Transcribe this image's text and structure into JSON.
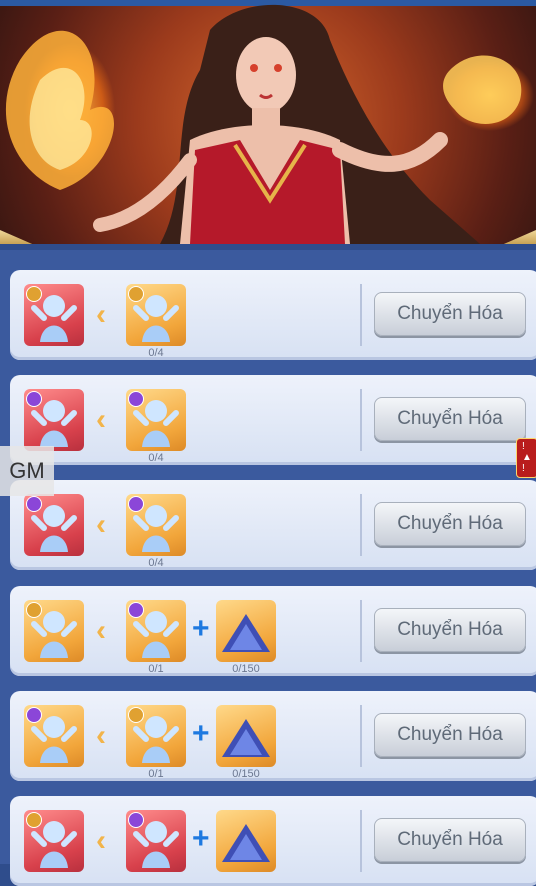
{
  "rows": [
    {
      "button_label": "Chuyển Hóa",
      "input_count": "0/4",
      "extra_count": ""
    },
    {
      "button_label": "Chuyển Hóa",
      "input_count": "0/4",
      "extra_count": ""
    },
    {
      "button_label": "Chuyển Hóa",
      "input_count": "0/4",
      "extra_count": ""
    },
    {
      "button_label": "Chuyển Hóa",
      "input_count": "0/1",
      "extra_count": "0/150"
    },
    {
      "button_label": "Chuyển Hóa",
      "input_count": "0/1",
      "extra_count": "0/150"
    },
    {
      "button_label": "Chuyển Hóa",
      "input_count": "",
      "extra_count": ""
    }
  ],
  "overlay": {
    "gm_label": "GM"
  },
  "icons": {
    "arrow": "arrow-left-icon",
    "plus": "plus-icon",
    "crystal": "crystal-dust-icon",
    "figure": "spirit-figure-icon"
  },
  "colors": {
    "accent_gold": "#f2b44a",
    "plus_blue": "#1e79e0",
    "list_bg": "#3b5a9e"
  }
}
